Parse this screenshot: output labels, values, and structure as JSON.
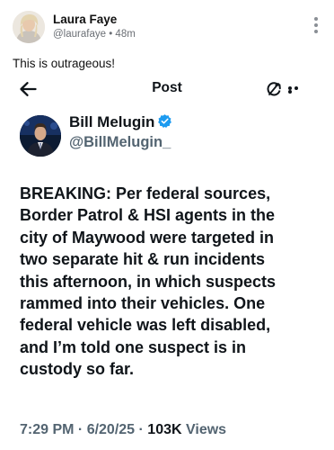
{
  "sharer": {
    "name": "Laura Faye",
    "handle": "@laurafaye",
    "separator": "•",
    "age": "48m",
    "caption": "This is outrageous!"
  },
  "embedded_post": {
    "bar_title": "Post",
    "author": {
      "name": "Bill Melugin",
      "handle": "@BillMelugin_",
      "verified": true
    },
    "body_lines": [
      "BREAKING: Per federal sources,",
      "Border Patrol & HSI agents in the",
      "city of Maywood were targeted in",
      "two separate hit & run incidents",
      "this afternoon, in which suspects",
      "rammed into their vehicles. One",
      "federal vehicle was left disabled,",
      "and I’m told one suspect is in",
      "custody so far."
    ],
    "meta": {
      "time": "7:29 PM",
      "dot1": " · ",
      "date": "6/20/25",
      "dot2": " · ",
      "views_count": "103K",
      "views_label": " Views"
    }
  },
  "icons": {
    "menu": "vertical-dots-icon",
    "back": "arrow-left-icon",
    "refresh": "refresh-icon",
    "more": "horizontal-dots-icon",
    "verified": "verified-badge-icon"
  },
  "colors": {
    "text": "#0f1419",
    "secondary": "#536471",
    "verified": "#1d9bf0",
    "meta_gray": "#6b6f75"
  }
}
